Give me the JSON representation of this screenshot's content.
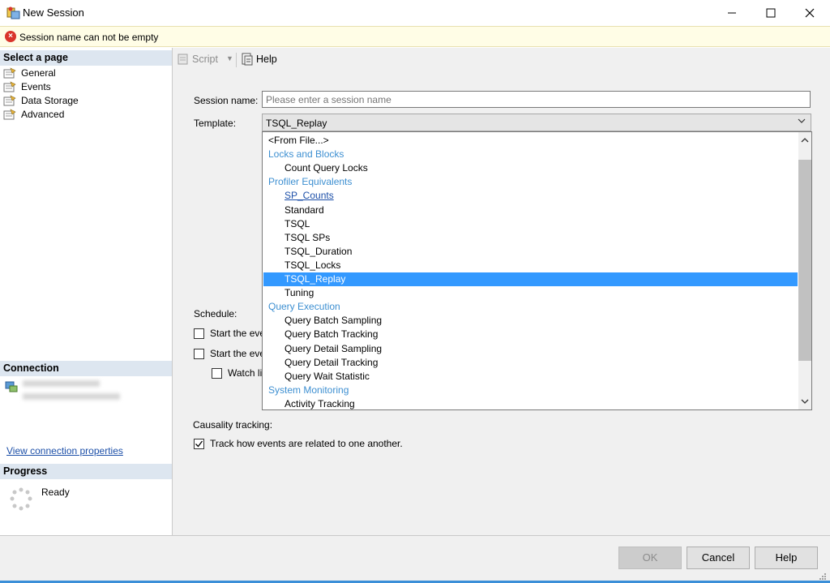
{
  "window": {
    "title": "New Session",
    "minimize_icon": "minimize-icon",
    "maximize_icon": "maximize-icon",
    "close_icon": "close-icon"
  },
  "error": {
    "message": "Session name can not be empty"
  },
  "left": {
    "select_page_header": "Select a page",
    "pages": [
      "General",
      "Events",
      "Data Storage",
      "Advanced"
    ],
    "connection_header": "Connection",
    "view_connection_link": "View connection properties",
    "progress_header": "Progress",
    "progress_status": "Ready"
  },
  "toolbar": {
    "script_label": "Script",
    "help_label": "Help"
  },
  "form": {
    "session_name_label": "Session name:",
    "session_name_placeholder": "Please enter a session name",
    "session_name_value": "",
    "template_label": "Template:",
    "template_value": "TSQL_Replay",
    "schedule_label": "Schedule:",
    "start_event_1": "Start the eve",
    "start_event_2": "Start the eve",
    "watch_live": "Watch li",
    "causality_label": "Causality tracking:",
    "track_label": "Track how events are related to one another.",
    "track_checked": true
  },
  "dropdown": {
    "items": [
      {
        "text": "<From File...>",
        "kind": "top"
      },
      {
        "text": "Locks and Blocks",
        "kind": "group"
      },
      {
        "text": "Count Query Locks",
        "kind": "child"
      },
      {
        "text": "Profiler Equivalents",
        "kind": "group"
      },
      {
        "text": "SP_Counts",
        "kind": "child-link"
      },
      {
        "text": "Standard",
        "kind": "child"
      },
      {
        "text": "TSQL",
        "kind": "child"
      },
      {
        "text": "TSQL SPs",
        "kind": "child"
      },
      {
        "text": "TSQL_Duration",
        "kind": "child"
      },
      {
        "text": "TSQL_Locks",
        "kind": "child"
      },
      {
        "text": "TSQL_Replay",
        "kind": "child-selected"
      },
      {
        "text": "Tuning",
        "kind": "child"
      },
      {
        "text": "Query Execution",
        "kind": "group"
      },
      {
        "text": "Query Batch Sampling",
        "kind": "child"
      },
      {
        "text": "Query Batch Tracking",
        "kind": "child"
      },
      {
        "text": "Query Detail Sampling",
        "kind": "child"
      },
      {
        "text": "Query Detail Tracking",
        "kind": "child"
      },
      {
        "text": "Query Wait Statistic",
        "kind": "child"
      },
      {
        "text": "System Monitoring",
        "kind": "group"
      },
      {
        "text": "Activity Tracking",
        "kind": "child"
      }
    ]
  },
  "buttons": {
    "ok": "OK",
    "cancel": "Cancel",
    "help": "Help"
  },
  "colors": {
    "error_red": "#d9342b",
    "selection_blue": "#3399ff",
    "group_blue": "#3d8fd1",
    "link_blue": "#1c4fa8"
  }
}
